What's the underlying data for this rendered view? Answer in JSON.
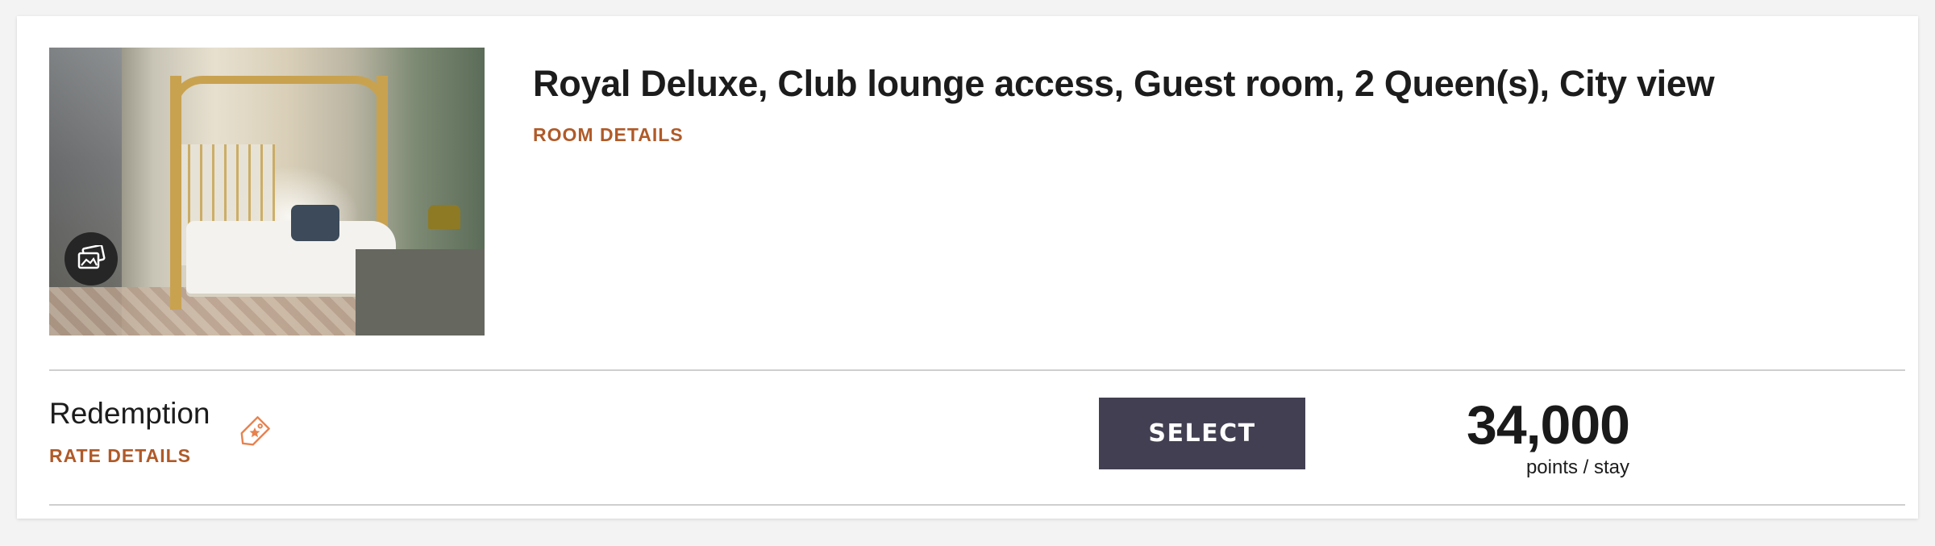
{
  "room": {
    "title": "Royal Deluxe, Club lounge access, Guest room, 2 Queen(s), City view",
    "details_link": "ROOM DETAILS",
    "image_icon": "photo-gallery-icon"
  },
  "rate": {
    "name": "Redemption",
    "tag_icon": "price-tag-star-icon",
    "details_link": "RATE DETAILS",
    "points": "34,000",
    "points_unit": "points / stay",
    "select_label": "SELECT"
  },
  "colors": {
    "link": "#b05a28",
    "button_bg": "#433f52",
    "button_text": "#ffffff",
    "divider": "#cfcfcf",
    "page_bg": "#f3f3f3"
  }
}
